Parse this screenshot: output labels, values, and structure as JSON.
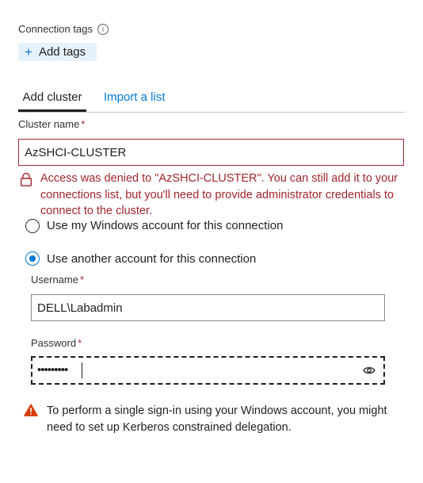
{
  "connection_tags": {
    "label": "Connection tags",
    "info_icon": "i",
    "add_tags_label": "Add tags",
    "add_icon": "+"
  },
  "tabs": [
    {
      "label": "Add cluster",
      "selected": true
    },
    {
      "label": "Import a list",
      "selected": false
    }
  ],
  "cluster_name": {
    "label": "Cluster name",
    "required_marker": "*",
    "value": "AzSHCI-CLUSTER"
  },
  "error": {
    "icon": "lock-icon",
    "message": "Access was denied to \"AzSHCI-CLUSTER\". You can still add it to your connections list, but you'll need to provide administrator credentials to connect to the cluster."
  },
  "auth_options": [
    {
      "label": "Use my Windows account for this connection",
      "selected": false
    },
    {
      "label": "Use another account for this connection",
      "selected": true
    }
  ],
  "username": {
    "label": "Username",
    "required_marker": "*",
    "value": "DELL\\Labadmin"
  },
  "password": {
    "label": "Password",
    "required_marker": "*",
    "masked_value": "•••••••••",
    "reveal_icon": "eye-icon"
  },
  "warning": {
    "icon": "warning-icon",
    "message": "To perform a single sign-in using your Windows account, you might need to set up Kerberos constrained delegation."
  },
  "colors": {
    "accent": "#0078d4",
    "error": "#a4262c",
    "warning": "#d83b01"
  }
}
